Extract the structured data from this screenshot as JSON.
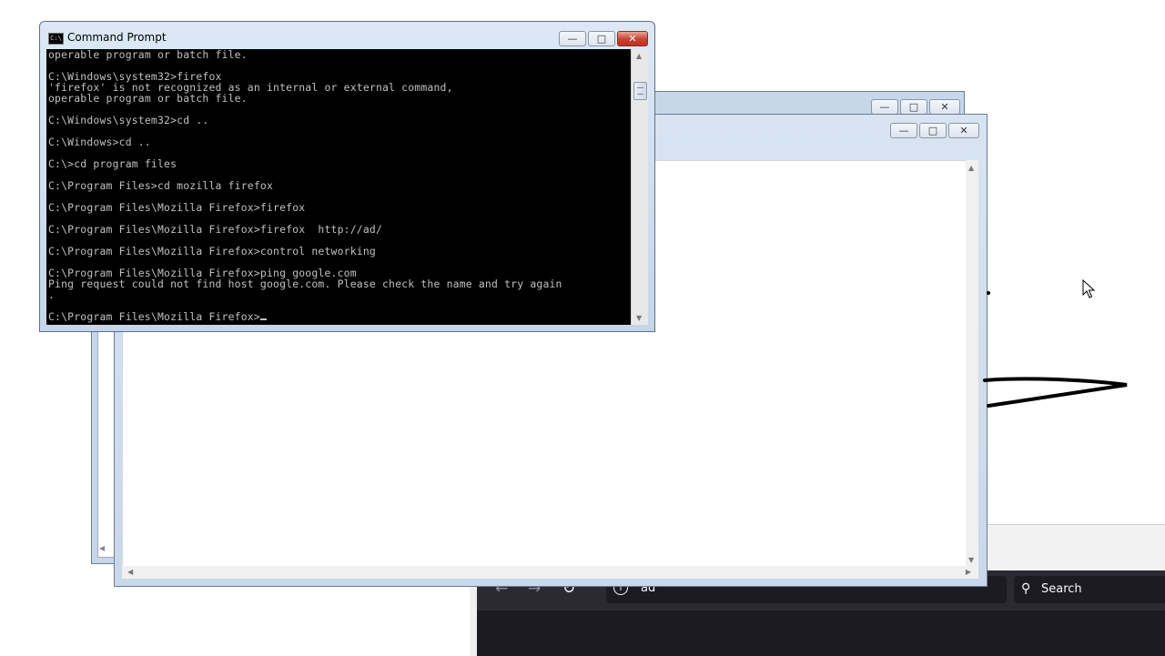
{
  "command_prompt": {
    "title": "Command Prompt",
    "lines": [
      "operable program or batch file.",
      "",
      "C:\\Windows\\system32>firefox",
      "'firefox' is not recognized as an internal or external command,",
      "operable program or batch file.",
      "",
      "C:\\Windows\\system32>cd ..",
      "",
      "C:\\Windows>cd ..",
      "",
      "C:\\>cd program files",
      "",
      "C:\\Program Files>cd mozilla firefox",
      "",
      "C:\\Program Files\\Mozilla Firefox>firefox",
      "",
      "C:\\Program Files\\Mozilla Firefox>firefox  http://ad/",
      "",
      "C:\\Program Files\\Mozilla Firefox>control networking",
      "",
      "C:\\Program Files\\Mozilla Firefox>ping google.com",
      "Ping request could not find host google.com. Please check the name and try again",
      ".",
      ""
    ],
    "prompt": "C:\\Program Files\\Mozilla Firefox>",
    "icon": "cmd-icon"
  },
  "window_controls": {
    "minimize": "—",
    "maximize": "□",
    "close": "✕"
  },
  "firefox": {
    "url_text": "ad",
    "search_placeholder": "Search",
    "icons": [
      "back-icon",
      "forward-icon",
      "reload-icon",
      "info-icon",
      "bookmark-star-icon",
      "search-icon"
    ]
  },
  "colors": {
    "console_bg": "#000000",
    "console_text": "#c0c0c0",
    "firefox_dark": "#1c1b22",
    "close_red": "#c9412f"
  }
}
